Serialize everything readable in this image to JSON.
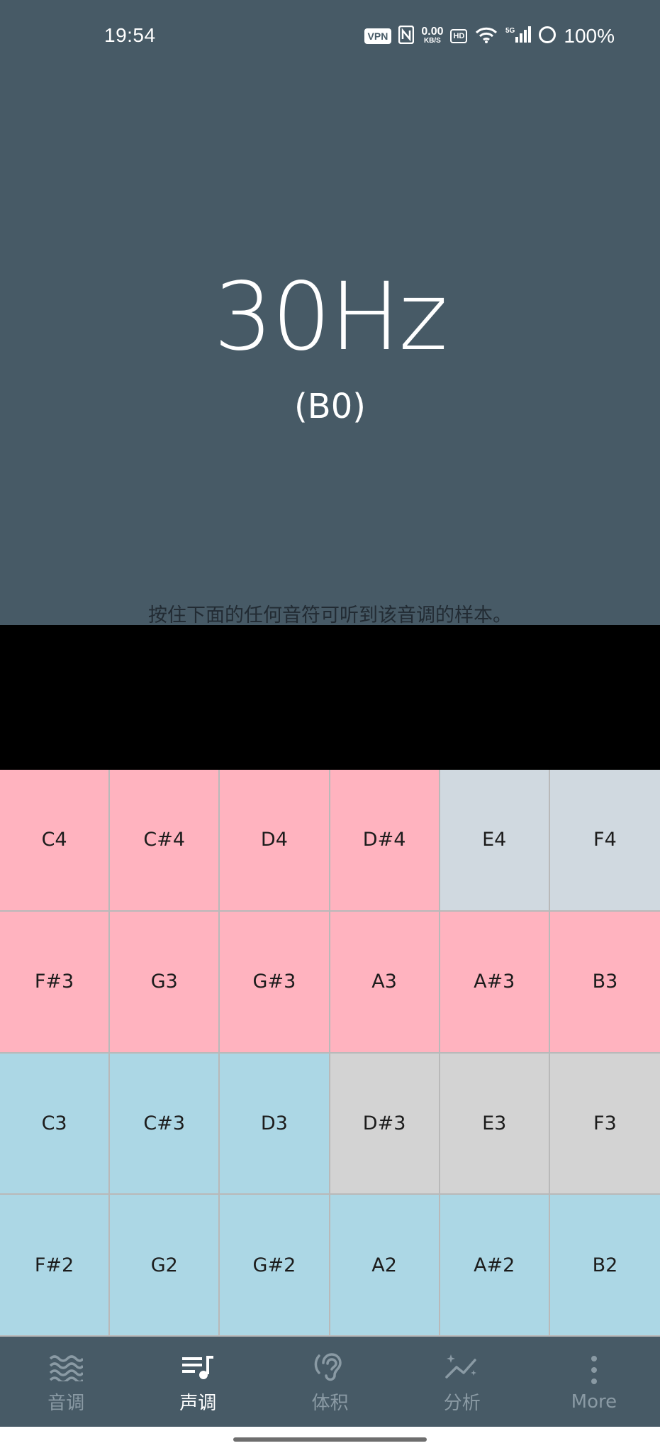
{
  "status_bar": {
    "time": "19:54",
    "vpn": "VPN",
    "net_speed_value": "0.00",
    "net_speed_unit": "KB/S",
    "hd": "HD",
    "battery": "100%",
    "icons": [
      "nfc-icon",
      "wifi-icon",
      "signal-5g-icon",
      "battery-ring-icon"
    ]
  },
  "display": {
    "frequency": "30Hz",
    "note": "(B0)"
  },
  "instruction": "按住下面的任何音符可听到该音调的样本。",
  "keys": [
    {
      "label": "C4",
      "color": "#ffb3bf"
    },
    {
      "label": "C#4",
      "color": "#ffb3bf"
    },
    {
      "label": "D4",
      "color": "#ffb3bf"
    },
    {
      "label": "D#4",
      "color": "#ffb3bf"
    },
    {
      "label": "E4",
      "color": "#d0d9e0"
    },
    {
      "label": "F4",
      "color": "#d0d9e0"
    },
    {
      "label": "F#3",
      "color": "#ffb3bf"
    },
    {
      "label": "G3",
      "color": "#ffb3bf"
    },
    {
      "label": "G#3",
      "color": "#ffb3bf"
    },
    {
      "label": "A3",
      "color": "#ffb3bf"
    },
    {
      "label": "A#3",
      "color": "#ffb3bf"
    },
    {
      "label": "B3",
      "color": "#ffb3bf"
    },
    {
      "label": "C3",
      "color": "#acd7e5"
    },
    {
      "label": "C#3",
      "color": "#acd7e5"
    },
    {
      "label": "D3",
      "color": "#acd7e5"
    },
    {
      "label": "D#3",
      "color": "#d3d3d3"
    },
    {
      "label": "E3",
      "color": "#d3d3d3"
    },
    {
      "label": "F3",
      "color": "#d3d3d3"
    },
    {
      "label": "F#2",
      "color": "#acd7e5"
    },
    {
      "label": "G2",
      "color": "#acd7e5"
    },
    {
      "label": "G#2",
      "color": "#acd7e5"
    },
    {
      "label": "A2",
      "color": "#acd7e5"
    },
    {
      "label": "A#2",
      "color": "#acd7e5"
    },
    {
      "label": "B2",
      "color": "#acd7e5"
    }
  ],
  "nav": {
    "items": [
      {
        "label": "音调",
        "icon": "waves-icon",
        "active": false
      },
      {
        "label": "声调",
        "icon": "music-list-icon",
        "active": true
      },
      {
        "label": "体积",
        "icon": "ear-icon",
        "active": false
      },
      {
        "label": "分析",
        "icon": "sparkle-graph-icon",
        "active": false
      },
      {
        "label": "More",
        "icon": "more-vertical-icon",
        "active": false
      }
    ]
  },
  "colors": {
    "header_bg": "#475a66",
    "nav_active": "#ffffff",
    "nav_inactive": "#8a9aa4",
    "key_pink": "#ffb3bf",
    "key_blue": "#acd7e5",
    "key_gray": "#d0d9e0",
    "key_lightgray": "#d3d3d3"
  }
}
